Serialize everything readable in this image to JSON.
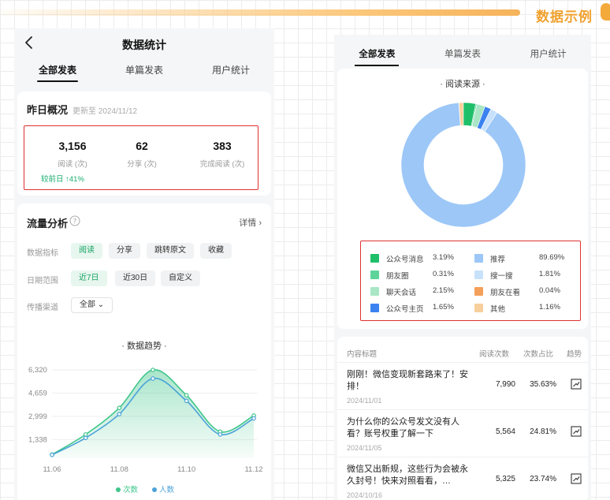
{
  "banner": {
    "title": "数据示例"
  },
  "left_panel": {
    "page_title": "数据统计",
    "tabs": [
      {
        "label": "全部发表",
        "active": true
      },
      {
        "label": "单篇发表"
      },
      {
        "label": "用户统计"
      }
    ],
    "overview": {
      "title": "昨日概况",
      "updated": "更新至 2024/11/12",
      "metrics": [
        {
          "value": "3,156",
          "label": "阅读 (次)"
        },
        {
          "value": "62",
          "label": "分享 (次)"
        },
        {
          "value": "383",
          "label": "完成阅读 (次)"
        }
      ],
      "compare": "较前日 ↑41%"
    },
    "flow": {
      "title": "流量分析",
      "detail": "详情",
      "rows": [
        {
          "label": "数据指标",
          "chips": [
            "阅读",
            "分享",
            "跳转原文",
            "收藏"
          ],
          "active": 0
        },
        {
          "label": "日期范围",
          "chips": [
            "近7日",
            "近30日",
            "自定义"
          ],
          "active": 0
        },
        {
          "label": "传播渠道",
          "chips": [
            "全部 ⌄"
          ],
          "active": -1
        }
      ]
    },
    "chart_data": {
      "type": "line",
      "title": "· 数据趋势 ·",
      "x": [
        "11.06",
        "11.07",
        "11.08",
        "11.09",
        "11.10",
        "11.11",
        "11.12"
      ],
      "x_tick_labels": [
        "11.06",
        "11.08",
        "11.10",
        "11.12"
      ],
      "y_tick_labels": [
        "1,338",
        "2,999",
        "4,659",
        "6,320"
      ],
      "ylim": [
        0,
        6320
      ],
      "series": [
        {
          "name": "次数",
          "color": "#3ec68a",
          "values": [
            260,
            1700,
            3600,
            6320,
            4500,
            1900,
            3050
          ]
        },
        {
          "name": "人数",
          "color": "#4aa3d8",
          "values": [
            240,
            1450,
            3150,
            5700,
            4100,
            1700,
            2850
          ]
        }
      ],
      "legend": "bottom"
    }
  },
  "right_panel": {
    "tabs": [
      {
        "label": "全部发表",
        "active": true
      },
      {
        "label": "单篇发表"
      },
      {
        "label": "用户统计"
      }
    ],
    "pie": {
      "chart_data": {
        "type": "pie",
        "title": "· 阅读来源 ·",
        "slices": [
          {
            "name": "公众号消息",
            "percent": "3.19%",
            "value": 3.19,
            "color": "#1fbf6a"
          },
          {
            "name": "朋友圈",
            "percent": "0.31%",
            "value": 0.31,
            "color": "#5fd49a"
          },
          {
            "name": "聊天会话",
            "percent": "2.15%",
            "value": 2.15,
            "color": "#a8e6c5"
          },
          {
            "name": "公众号主页",
            "percent": "1.65%",
            "value": 1.65,
            "color": "#3b82f0"
          },
          {
            "name": "推荐",
            "percent": "89.69%",
            "value": 89.69,
            "color": "#9cc7f7"
          },
          {
            "name": "搜一搜",
            "percent": "1.81%",
            "value": 1.81,
            "color": "#c8e1fb"
          },
          {
            "name": "朋友在看",
            "percent": "0.04%",
            "value": 0.04,
            "color": "#f5a05a"
          },
          {
            "name": "其他",
            "percent": "1.16%",
            "value": 1.16,
            "color": "#f7cf9c"
          }
        ],
        "legend": "bottom"
      }
    },
    "table": {
      "headers": [
        "内容标题",
        "阅读次数",
        "次数占比",
        "趋势"
      ],
      "rows": [
        {
          "title": "刚刚！微信变现新套路来了！安排！",
          "date": "2024/11/01",
          "count": "7,990",
          "ratio": "35.63%"
        },
        {
          "title": "为什么你的公众号发文没有人看？账号权重了解一下",
          "date": "2024/11/05",
          "count": "5,564",
          "ratio": "24.81%"
        },
        {
          "title": "微信又出新规，这些行为会被永久封号！快来对照看看，…",
          "date": "2024/10/16",
          "count": "5,325",
          "ratio": "23.74%"
        }
      ]
    }
  }
}
